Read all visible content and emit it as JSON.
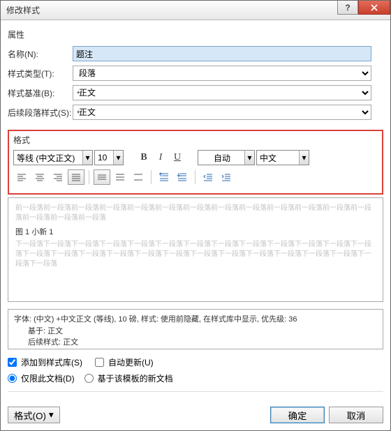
{
  "title": "修改样式",
  "sections": {
    "properties_label": "属性",
    "name_label": "名称(N):",
    "name_value": "题注",
    "type_label": "样式类型(T):",
    "type_value": "段落",
    "base_label": "样式基准(B):",
    "base_value": "正文",
    "follow_label": "后续段落样式(S):",
    "follow_value": "正文"
  },
  "format": {
    "label": "格式",
    "font": "等线 (中文正文)",
    "size": "10",
    "color_label": "自动",
    "lang": "中文"
  },
  "preview": {
    "ghost_before": "前一段落前一段落前一段落前一段落前一段落前一段落前一段落前一段落前一段落前一段落前一段落前一段落前一段落前一段落前一段落前一段落",
    "main": "图 1 小新 1",
    "ghost_after": "下一段落下一段落下一段落下一段落下一段落下一段落下一段落下一段落下一段落下一段落下一段落下一段落下一段落下一段落下一段落下一段落下一段落下一段落下一段落下一段落下一段落下一段落下一段落下一段落下一段落下一段落下一段落"
  },
  "description": {
    "line1": "字体: (中文) +中文正文 (等线), 10 磅, 样式: 使用前隐藏, 在样式库中显示, 优先级: 36",
    "line2": "基于: 正文",
    "line3": "后续样式: 正文"
  },
  "options": {
    "add_to_gallery": "添加到样式库(S)",
    "auto_update": "自动更新(U)",
    "only_this_doc": "仅限此文档(D)",
    "based_template": "基于该模板的新文档"
  },
  "footer": {
    "format_btn": "格式(O)",
    "ok": "确定",
    "cancel": "取消"
  }
}
